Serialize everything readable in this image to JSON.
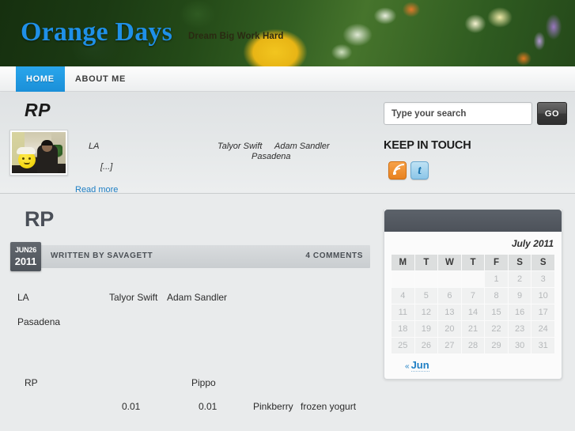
{
  "site": {
    "title": "Orange Days",
    "tagline": "Dream Big Work Hard"
  },
  "nav": {
    "items": [
      {
        "label": "HOME",
        "active": true
      },
      {
        "label": "ABOUT ME",
        "active": false
      }
    ]
  },
  "featured": {
    "title": "RP",
    "thumbnail_alt": "post-thumbnail",
    "fragments": {
      "la": "LA",
      "talyor_swift": "Talyor Swift",
      "adam_sandler": "Adam Sandler",
      "pasadena": "Pasadena",
      "ellipsis": "[...]"
    },
    "read_more": "Read more"
  },
  "search": {
    "placeholder": "Type your search",
    "value": "",
    "button_label": "GO"
  },
  "keep_in_touch": {
    "title": "KEEP IN TOUCH",
    "icons": [
      {
        "name": "rss-icon",
        "label": "RSS"
      },
      {
        "name": "twitter-icon",
        "label": "t"
      }
    ]
  },
  "post": {
    "title": "RP",
    "date": {
      "day": "JUN26",
      "year": "2011"
    },
    "author_line": "WRITTEN BY SAVAGETT",
    "comments": "4 COMMENTS",
    "body": {
      "la": "LA",
      "talyor_swift": "Talyor Swift",
      "adam_sandler": "Adam Sandler",
      "pasadena": "Pasadena",
      "rp": "RP",
      "pippo": "Pippo",
      "num1": "0.01",
      "num2": "0.01",
      "pinkberry": "Pinkberry",
      "frozen_yogurt": "frozen yogurt"
    }
  },
  "calendar": {
    "caption": "July 2011",
    "weekdays": [
      "M",
      "T",
      "W",
      "T",
      "F",
      "S",
      "S"
    ],
    "weeks": [
      [
        "",
        "",
        "",
        "",
        "1",
        "2",
        "3"
      ],
      [
        "4",
        "5",
        "6",
        "7",
        "8",
        "9",
        "10"
      ],
      [
        "11",
        "12",
        "13",
        "14",
        "15",
        "16",
        "17"
      ],
      [
        "18",
        "19",
        "20",
        "21",
        "22",
        "23",
        "24"
      ],
      [
        "25",
        "26",
        "27",
        "28",
        "29",
        "30",
        "31"
      ]
    ],
    "prev_label": "Jun",
    "prev_chevron": "«"
  },
  "colors": {
    "brand_blue": "#1f90e8",
    "nav_active": "#1a8fd8",
    "link_blue": "#1f7fc4",
    "badge_dark": "#4f545b",
    "calendar_header": "#4d525a"
  }
}
